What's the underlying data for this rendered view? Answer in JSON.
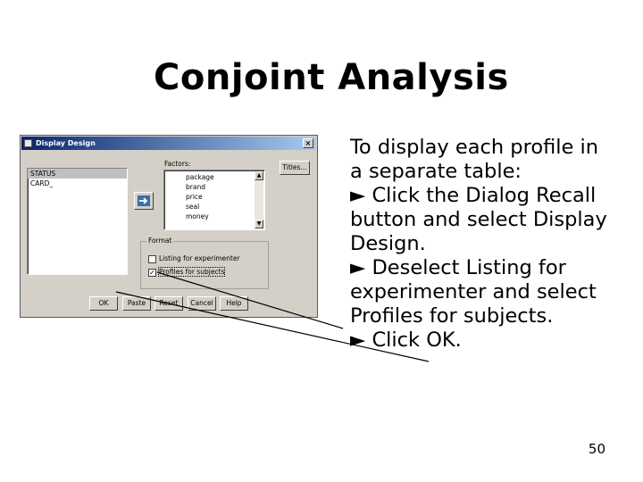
{
  "slide": {
    "title": "Conjoint Analysis",
    "body_lines": [
      "To display each profile in",
      "a separate table:",
      "► Click the Dialog Recall",
      "button and select Display",
      "Design.",
      "► Deselect Listing for",
      "experimenter and select",
      "Profiles for subjects.",
      "► Click OK."
    ],
    "page_number": "50"
  },
  "dialog": {
    "title": "Display Design",
    "close_glyph": "×",
    "source_list": [
      {
        "label": "STATUS",
        "selected": true
      },
      {
        "label": "CARD_",
        "selected": false
      }
    ],
    "move_arrow_glyph": "➜",
    "factors_label": "Factors:",
    "factors": [
      "package",
      "brand",
      "price",
      "seal",
      "money"
    ],
    "titles_button": "Titles...",
    "format": {
      "label": "Format",
      "listing_for_experimenter": {
        "label": "Listing for experimenter",
        "checked": false
      },
      "profiles_for_subjects": {
        "label": "Profiles for subjects",
        "checked": true
      },
      "check_glyph": "✓"
    },
    "scroll_up_glyph": "▲",
    "scroll_down_glyph": "▼",
    "buttons": {
      "ok": "OK",
      "paste": "Paste",
      "reset": "Reset",
      "cancel": "Cancel",
      "help": "Help"
    }
  },
  "colors": {
    "dialog_face": "#d4d0c8",
    "titlebar_start": "#0a246a",
    "titlebar_end": "#a6caf0",
    "arrow_blue": "#3a6ea5"
  }
}
